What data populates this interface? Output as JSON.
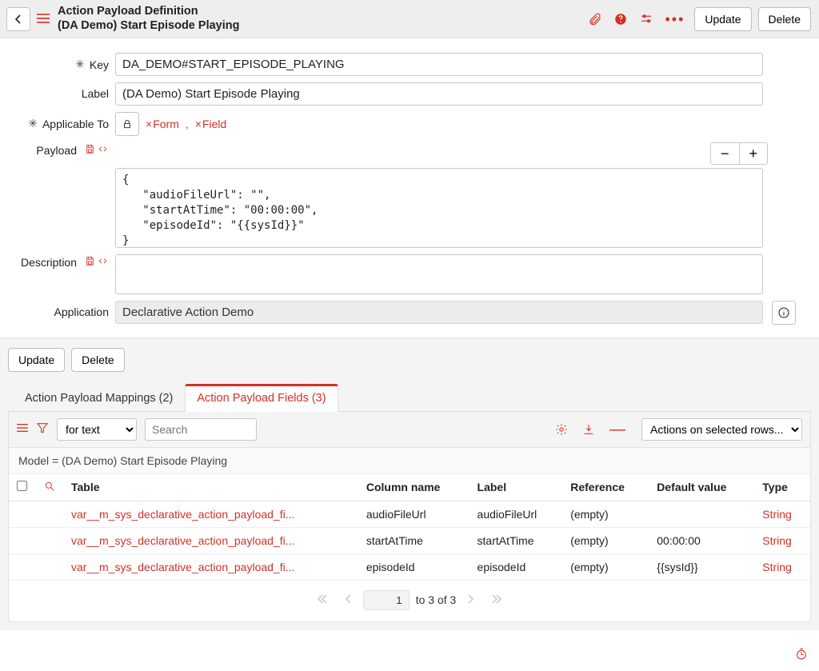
{
  "header": {
    "type_label": "Action Payload Definition",
    "record_label": "(DA Demo) Start Episode Playing",
    "update_btn": "Update",
    "delete_btn": "Delete"
  },
  "form": {
    "key_label": "Key",
    "key_value": "DA_DEMO#START_EPISODE_PLAYING",
    "label_label": "Label",
    "label_value": "(DA Demo) Start Episode Playing",
    "applicable_label": "Applicable To",
    "applicable_chips": [
      "Form",
      "Field"
    ],
    "payload_label": "Payload",
    "payload_value": "{\n   \"audioFileUrl\": \"\",\n   \"startAtTime\": \"00:00:00\",\n   \"episodeId\": \"{{sysId}}\"\n}",
    "description_label": "Description",
    "description_value": "",
    "application_label": "Application",
    "application_value": "Declarative Action Demo"
  },
  "lower": {
    "update_btn": "Update",
    "delete_btn": "Delete"
  },
  "tabs": {
    "mappings": "Action Payload Mappings (2)",
    "fields": "Action Payload Fields (3)"
  },
  "table": {
    "filter_mode": "for text",
    "search_placeholder": "Search",
    "actions_placeholder": "Actions on selected rows...",
    "model_line": "Model = (DA Demo) Start Episode Playing",
    "columns": {
      "table": "Table",
      "column_name": "Column name",
      "label": "Label",
      "reference": "Reference",
      "default_value": "Default value",
      "type": "Type"
    },
    "rows": [
      {
        "table": "var__m_sys_declarative_action_payload_fi...",
        "column_name": "audioFileUrl",
        "label": "audioFileUrl",
        "reference": "(empty)",
        "default_value": "",
        "type": "String"
      },
      {
        "table": "var__m_sys_declarative_action_payload_fi...",
        "column_name": "startAtTime",
        "label": "startAtTime",
        "reference": "(empty)",
        "default_value": "00:00:00",
        "type": "String"
      },
      {
        "table": "var__m_sys_declarative_action_payload_fi...",
        "column_name": "episodeId",
        "label": "episodeId",
        "reference": "(empty)",
        "default_value": "{{sysId}}",
        "type": "String"
      }
    ],
    "pager": {
      "page": "1",
      "suffix": "to 3 of 3"
    }
  }
}
